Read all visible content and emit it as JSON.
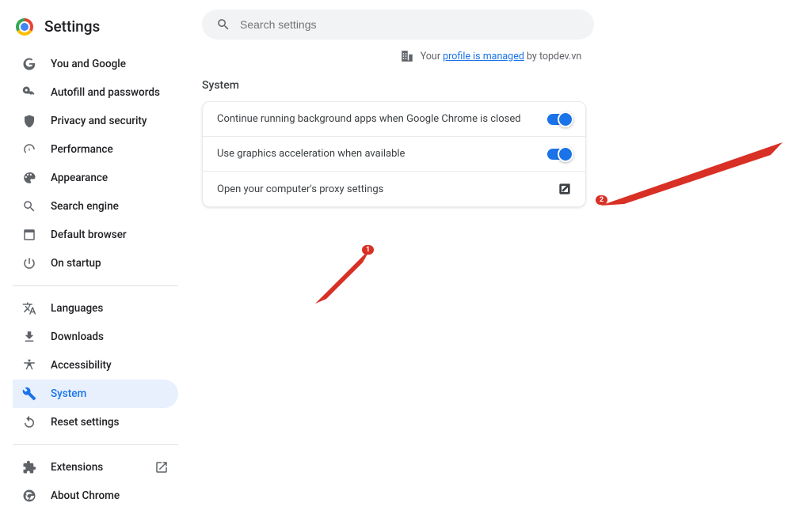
{
  "header": {
    "title": "Settings"
  },
  "search": {
    "placeholder": "Search settings"
  },
  "managed": {
    "prefix": "Your ",
    "link": "profile is managed",
    "suffix": " by topdev.vn"
  },
  "sidebar": {
    "items": [
      {
        "label": "You and Google"
      },
      {
        "label": "Autofill and passwords"
      },
      {
        "label": "Privacy and security"
      },
      {
        "label": "Performance"
      },
      {
        "label": "Appearance"
      },
      {
        "label": "Search engine"
      },
      {
        "label": "Default browser"
      },
      {
        "label": "On startup"
      },
      {
        "label": "Languages"
      },
      {
        "label": "Downloads"
      },
      {
        "label": "Accessibility"
      },
      {
        "label": "System"
      },
      {
        "label": "Reset settings"
      },
      {
        "label": "Extensions"
      },
      {
        "label": "About Chrome"
      }
    ]
  },
  "section": {
    "title": "System"
  },
  "rows": [
    {
      "label": "Continue running background apps when Google Chrome is closed"
    },
    {
      "label": "Use graphics acceleration when available"
    },
    {
      "label": "Open your computer's proxy settings"
    }
  ],
  "annotations": {
    "one": "1",
    "two": "2"
  }
}
